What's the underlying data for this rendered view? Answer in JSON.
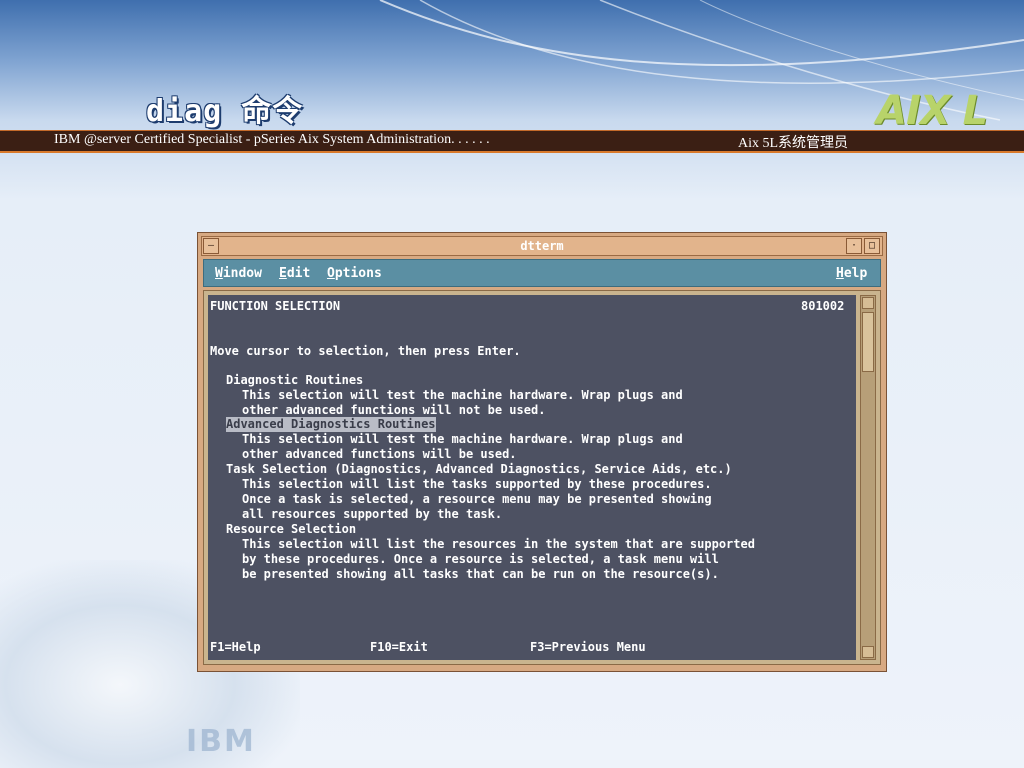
{
  "slide": {
    "title": "diag 命令",
    "banner_left": "IBM @server Certified Specialist - pSeries Aix System Administration. . . . . .",
    "banner_right": "Aix 5L系统管理员",
    "logo": "AIX L",
    "watermark": "IBM"
  },
  "window": {
    "title": "dtterm",
    "menu": [
      "Window",
      "Edit",
      "Options"
    ],
    "help": "Help"
  },
  "terminal": {
    "header_left": "FUNCTION SELECTION",
    "header_right": "801002",
    "instruction": "Move cursor to selection, then press Enter.",
    "options": [
      {
        "label": "Diagnostic Routines",
        "description": [
          "This selection will test the machine hardware. Wrap plugs and",
          "other advanced functions will not be used."
        ]
      },
      {
        "label": "Advanced Diagnostics Routines",
        "description": [
          "This selection will test the machine hardware. Wrap plugs and",
          "other advanced functions will be used."
        ]
      },
      {
        "label": "Task Selection (Diagnostics, Advanced Diagnostics, Service Aids, etc.)",
        "description": [
          "This selection will list the tasks supported by these procedures.",
          "Once a task is selected, a resource menu may be presented showing",
          "all resources supported by the task."
        ]
      },
      {
        "label": "Resource Selection",
        "description": [
          "This selection will list the resources in the system that are supported",
          "by these procedures. Once a resource is selected, a task menu will",
          "be presented showing all tasks that can be run on the resource(s)."
        ]
      }
    ],
    "keys": [
      "F1=Help",
      "F10=Exit",
      "F3=Previous Menu"
    ]
  },
  "colors": {
    "terminal_bg": "#4d5162",
    "menubar": "#5b8fa3",
    "window_frame": "#d7a982",
    "banner": "#3b1f14"
  }
}
